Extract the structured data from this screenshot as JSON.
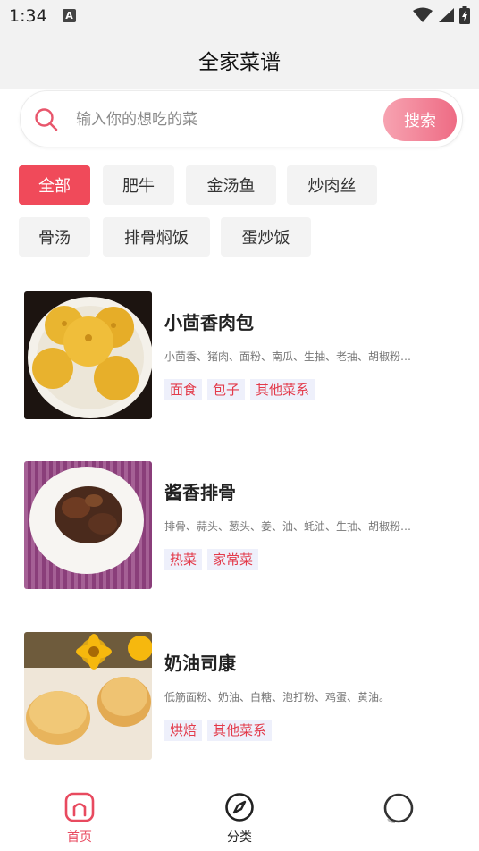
{
  "status": {
    "time": "1:34",
    "notification_badge": "A"
  },
  "header": {
    "title": "全家菜谱"
  },
  "search": {
    "placeholder": "输入你的想吃的菜",
    "button": "搜索"
  },
  "filters": [
    {
      "label": "全部",
      "active": true
    },
    {
      "label": "肥牛",
      "active": false
    },
    {
      "label": "金汤鱼",
      "active": false
    },
    {
      "label": "炒肉丝",
      "active": false
    },
    {
      "label": "骨汤",
      "active": false
    },
    {
      "label": "排骨焖饭",
      "active": false
    },
    {
      "label": "蛋炒饭",
      "active": false
    }
  ],
  "recipes": [
    {
      "title": "小茴香肉包",
      "ingredients": "小茴香、猪肉、面粉、南瓜、生抽、老抽、胡椒粉…",
      "tags": [
        "面食",
        "包子",
        "其他菜系"
      ]
    },
    {
      "title": "酱香排骨",
      "ingredients": "排骨、蒜头、葱头、姜、油、蚝油、生抽、胡椒粉…",
      "tags": [
        "热菜",
        "家常菜"
      ]
    },
    {
      "title": "奶油司康",
      "ingredients": "低筋面粉、奶油、白糖、泡打粉、鸡蛋、黄油。",
      "tags": [
        "烘焙",
        "其他菜系"
      ]
    }
  ],
  "tabs": [
    {
      "label": "首页",
      "icon": "home-icon",
      "active": true
    },
    {
      "label": "分类",
      "icon": "compass-icon",
      "active": false
    },
    {
      "label": "",
      "icon": "profile-icon",
      "active": false
    }
  ],
  "colors": {
    "accent": "#f04a5a",
    "tag_text": "#e33a4a",
    "tag_bg": "#eef0fb",
    "tab_active": "#e84a5f"
  }
}
